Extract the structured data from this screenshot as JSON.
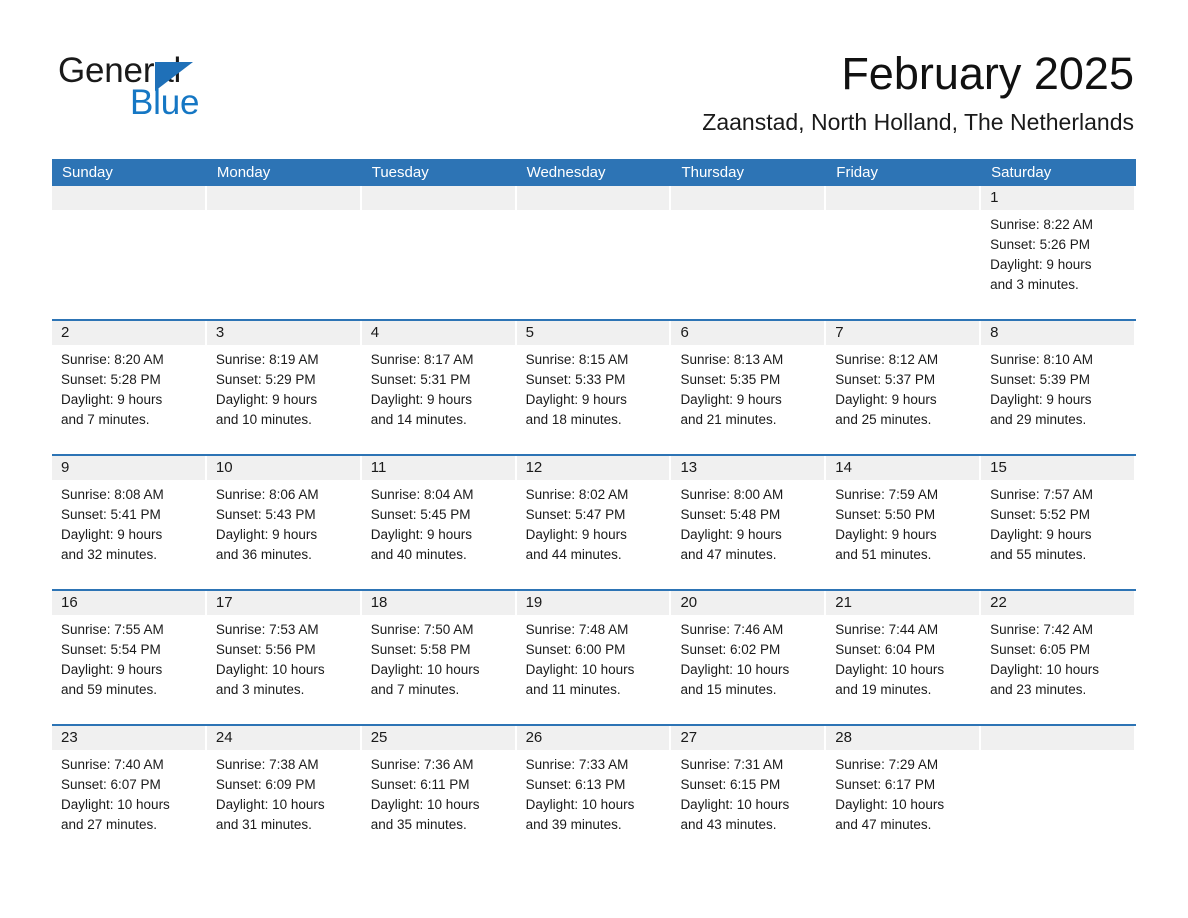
{
  "brand": {
    "name_part1": "General",
    "name_part2": "Blue",
    "triangle_color": "#1f70b8",
    "blue_color": "#1577c4"
  },
  "header": {
    "month_title": "February 2025",
    "location": "Zaanstad, North Holland, The Netherlands"
  },
  "theme": {
    "header_blue": "#2d74b5",
    "day_band_gray": "#f0f0f0",
    "text": "#1a1a1a"
  },
  "calendar": {
    "weekday_headers": [
      "Sunday",
      "Monday",
      "Tuesday",
      "Wednesday",
      "Thursday",
      "Friday",
      "Saturday"
    ],
    "weeks": [
      [
        {
          "day": "",
          "sunrise": "",
          "sunset": "",
          "daylight": "",
          "daylight2": ""
        },
        {
          "day": "",
          "sunrise": "",
          "sunset": "",
          "daylight": "",
          "daylight2": ""
        },
        {
          "day": "",
          "sunrise": "",
          "sunset": "",
          "daylight": "",
          "daylight2": ""
        },
        {
          "day": "",
          "sunrise": "",
          "sunset": "",
          "daylight": "",
          "daylight2": ""
        },
        {
          "day": "",
          "sunrise": "",
          "sunset": "",
          "daylight": "",
          "daylight2": ""
        },
        {
          "day": "",
          "sunrise": "",
          "sunset": "",
          "daylight": "",
          "daylight2": ""
        },
        {
          "day": "1",
          "sunrise": "Sunrise: 8:22 AM",
          "sunset": "Sunset: 5:26 PM",
          "daylight": "Daylight: 9 hours",
          "daylight2": "and 3 minutes."
        }
      ],
      [
        {
          "day": "2",
          "sunrise": "Sunrise: 8:20 AM",
          "sunset": "Sunset: 5:28 PM",
          "daylight": "Daylight: 9 hours",
          "daylight2": "and 7 minutes."
        },
        {
          "day": "3",
          "sunrise": "Sunrise: 8:19 AM",
          "sunset": "Sunset: 5:29 PM",
          "daylight": "Daylight: 9 hours",
          "daylight2": "and 10 minutes."
        },
        {
          "day": "4",
          "sunrise": "Sunrise: 8:17 AM",
          "sunset": "Sunset: 5:31 PM",
          "daylight": "Daylight: 9 hours",
          "daylight2": "and 14 minutes."
        },
        {
          "day": "5",
          "sunrise": "Sunrise: 8:15 AM",
          "sunset": "Sunset: 5:33 PM",
          "daylight": "Daylight: 9 hours",
          "daylight2": "and 18 minutes."
        },
        {
          "day": "6",
          "sunrise": "Sunrise: 8:13 AM",
          "sunset": "Sunset: 5:35 PM",
          "daylight": "Daylight: 9 hours",
          "daylight2": "and 21 minutes."
        },
        {
          "day": "7",
          "sunrise": "Sunrise: 8:12 AM",
          "sunset": "Sunset: 5:37 PM",
          "daylight": "Daylight: 9 hours",
          "daylight2": "and 25 minutes."
        },
        {
          "day": "8",
          "sunrise": "Sunrise: 8:10 AM",
          "sunset": "Sunset: 5:39 PM",
          "daylight": "Daylight: 9 hours",
          "daylight2": "and 29 minutes."
        }
      ],
      [
        {
          "day": "9",
          "sunrise": "Sunrise: 8:08 AM",
          "sunset": "Sunset: 5:41 PM",
          "daylight": "Daylight: 9 hours",
          "daylight2": "and 32 minutes."
        },
        {
          "day": "10",
          "sunrise": "Sunrise: 8:06 AM",
          "sunset": "Sunset: 5:43 PM",
          "daylight": "Daylight: 9 hours",
          "daylight2": "and 36 minutes."
        },
        {
          "day": "11",
          "sunrise": "Sunrise: 8:04 AM",
          "sunset": "Sunset: 5:45 PM",
          "daylight": "Daylight: 9 hours",
          "daylight2": "and 40 minutes."
        },
        {
          "day": "12",
          "sunrise": "Sunrise: 8:02 AM",
          "sunset": "Sunset: 5:47 PM",
          "daylight": "Daylight: 9 hours",
          "daylight2": "and 44 minutes."
        },
        {
          "day": "13",
          "sunrise": "Sunrise: 8:00 AM",
          "sunset": "Sunset: 5:48 PM",
          "daylight": "Daylight: 9 hours",
          "daylight2": "and 47 minutes."
        },
        {
          "day": "14",
          "sunrise": "Sunrise: 7:59 AM",
          "sunset": "Sunset: 5:50 PM",
          "daylight": "Daylight: 9 hours",
          "daylight2": "and 51 minutes."
        },
        {
          "day": "15",
          "sunrise": "Sunrise: 7:57 AM",
          "sunset": "Sunset: 5:52 PM",
          "daylight": "Daylight: 9 hours",
          "daylight2": "and 55 minutes."
        }
      ],
      [
        {
          "day": "16",
          "sunrise": "Sunrise: 7:55 AM",
          "sunset": "Sunset: 5:54 PM",
          "daylight": "Daylight: 9 hours",
          "daylight2": "and 59 minutes."
        },
        {
          "day": "17",
          "sunrise": "Sunrise: 7:53 AM",
          "sunset": "Sunset: 5:56 PM",
          "daylight": "Daylight: 10 hours",
          "daylight2": "and 3 minutes."
        },
        {
          "day": "18",
          "sunrise": "Sunrise: 7:50 AM",
          "sunset": "Sunset: 5:58 PM",
          "daylight": "Daylight: 10 hours",
          "daylight2": "and 7 minutes."
        },
        {
          "day": "19",
          "sunrise": "Sunrise: 7:48 AM",
          "sunset": "Sunset: 6:00 PM",
          "daylight": "Daylight: 10 hours",
          "daylight2": "and 11 minutes."
        },
        {
          "day": "20",
          "sunrise": "Sunrise: 7:46 AM",
          "sunset": "Sunset: 6:02 PM",
          "daylight": "Daylight: 10 hours",
          "daylight2": "and 15 minutes."
        },
        {
          "day": "21",
          "sunrise": "Sunrise: 7:44 AM",
          "sunset": "Sunset: 6:04 PM",
          "daylight": "Daylight: 10 hours",
          "daylight2": "and 19 minutes."
        },
        {
          "day": "22",
          "sunrise": "Sunrise: 7:42 AM",
          "sunset": "Sunset: 6:05 PM",
          "daylight": "Daylight: 10 hours",
          "daylight2": "and 23 minutes."
        }
      ],
      [
        {
          "day": "23",
          "sunrise": "Sunrise: 7:40 AM",
          "sunset": "Sunset: 6:07 PM",
          "daylight": "Daylight: 10 hours",
          "daylight2": "and 27 minutes."
        },
        {
          "day": "24",
          "sunrise": "Sunrise: 7:38 AM",
          "sunset": "Sunset: 6:09 PM",
          "daylight": "Daylight: 10 hours",
          "daylight2": "and 31 minutes."
        },
        {
          "day": "25",
          "sunrise": "Sunrise: 7:36 AM",
          "sunset": "Sunset: 6:11 PM",
          "daylight": "Daylight: 10 hours",
          "daylight2": "and 35 minutes."
        },
        {
          "day": "26",
          "sunrise": "Sunrise: 7:33 AM",
          "sunset": "Sunset: 6:13 PM",
          "daylight": "Daylight: 10 hours",
          "daylight2": "and 39 minutes."
        },
        {
          "day": "27",
          "sunrise": "Sunrise: 7:31 AM",
          "sunset": "Sunset: 6:15 PM",
          "daylight": "Daylight: 10 hours",
          "daylight2": "and 43 minutes."
        },
        {
          "day": "28",
          "sunrise": "Sunrise: 7:29 AM",
          "sunset": "Sunset: 6:17 PM",
          "daylight": "Daylight: 10 hours",
          "daylight2": "and 47 minutes."
        },
        {
          "day": "",
          "sunrise": "",
          "sunset": "",
          "daylight": "",
          "daylight2": ""
        }
      ]
    ]
  }
}
